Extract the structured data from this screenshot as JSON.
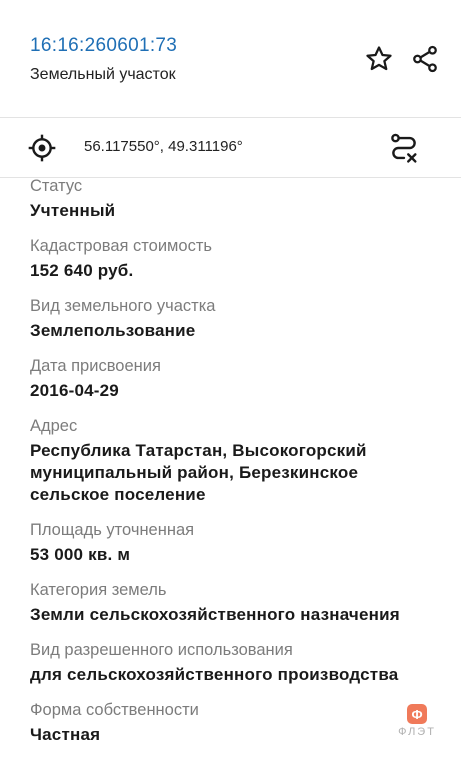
{
  "header": {
    "cadastral_number": "16:16:260601:73",
    "object_type": "Земельный участок",
    "favorite_icon": "star-icon",
    "share_icon": "share-icon"
  },
  "coords": {
    "value": "56.117550°, 49.311196°",
    "locate_icon": "location-target-icon",
    "route_icon": "route-icon"
  },
  "fields": [
    {
      "label": "Статус",
      "value": "Учтенный"
    },
    {
      "label": "Кадастровая стоимость",
      "value": "152 640 руб."
    },
    {
      "label": "Вид земельного участка",
      "value": "Землепользование"
    },
    {
      "label": "Дата присвоения",
      "value": "2016-04-29"
    },
    {
      "label": "Адрес",
      "value": "Республика Татарстан, Высокогорский муниципальный район, Березкинское сельское поселение"
    },
    {
      "label": "Площадь уточненная",
      "value": "53 000 кв. м"
    },
    {
      "label": "Категория земель",
      "value": "Земли сельскохозяйственного назначения"
    },
    {
      "label": "Вид разрешенного использования",
      "value": "для сельскохозяйственного производства"
    },
    {
      "label": "Форма собственности",
      "value": "Частная"
    }
  ],
  "watermark": {
    "badge": "Ф",
    "text": "ФЛЭТ"
  },
  "colors": {
    "accent": "#1f6fb5",
    "label": "#7c7c7c",
    "watermark": "#f07a5a"
  }
}
